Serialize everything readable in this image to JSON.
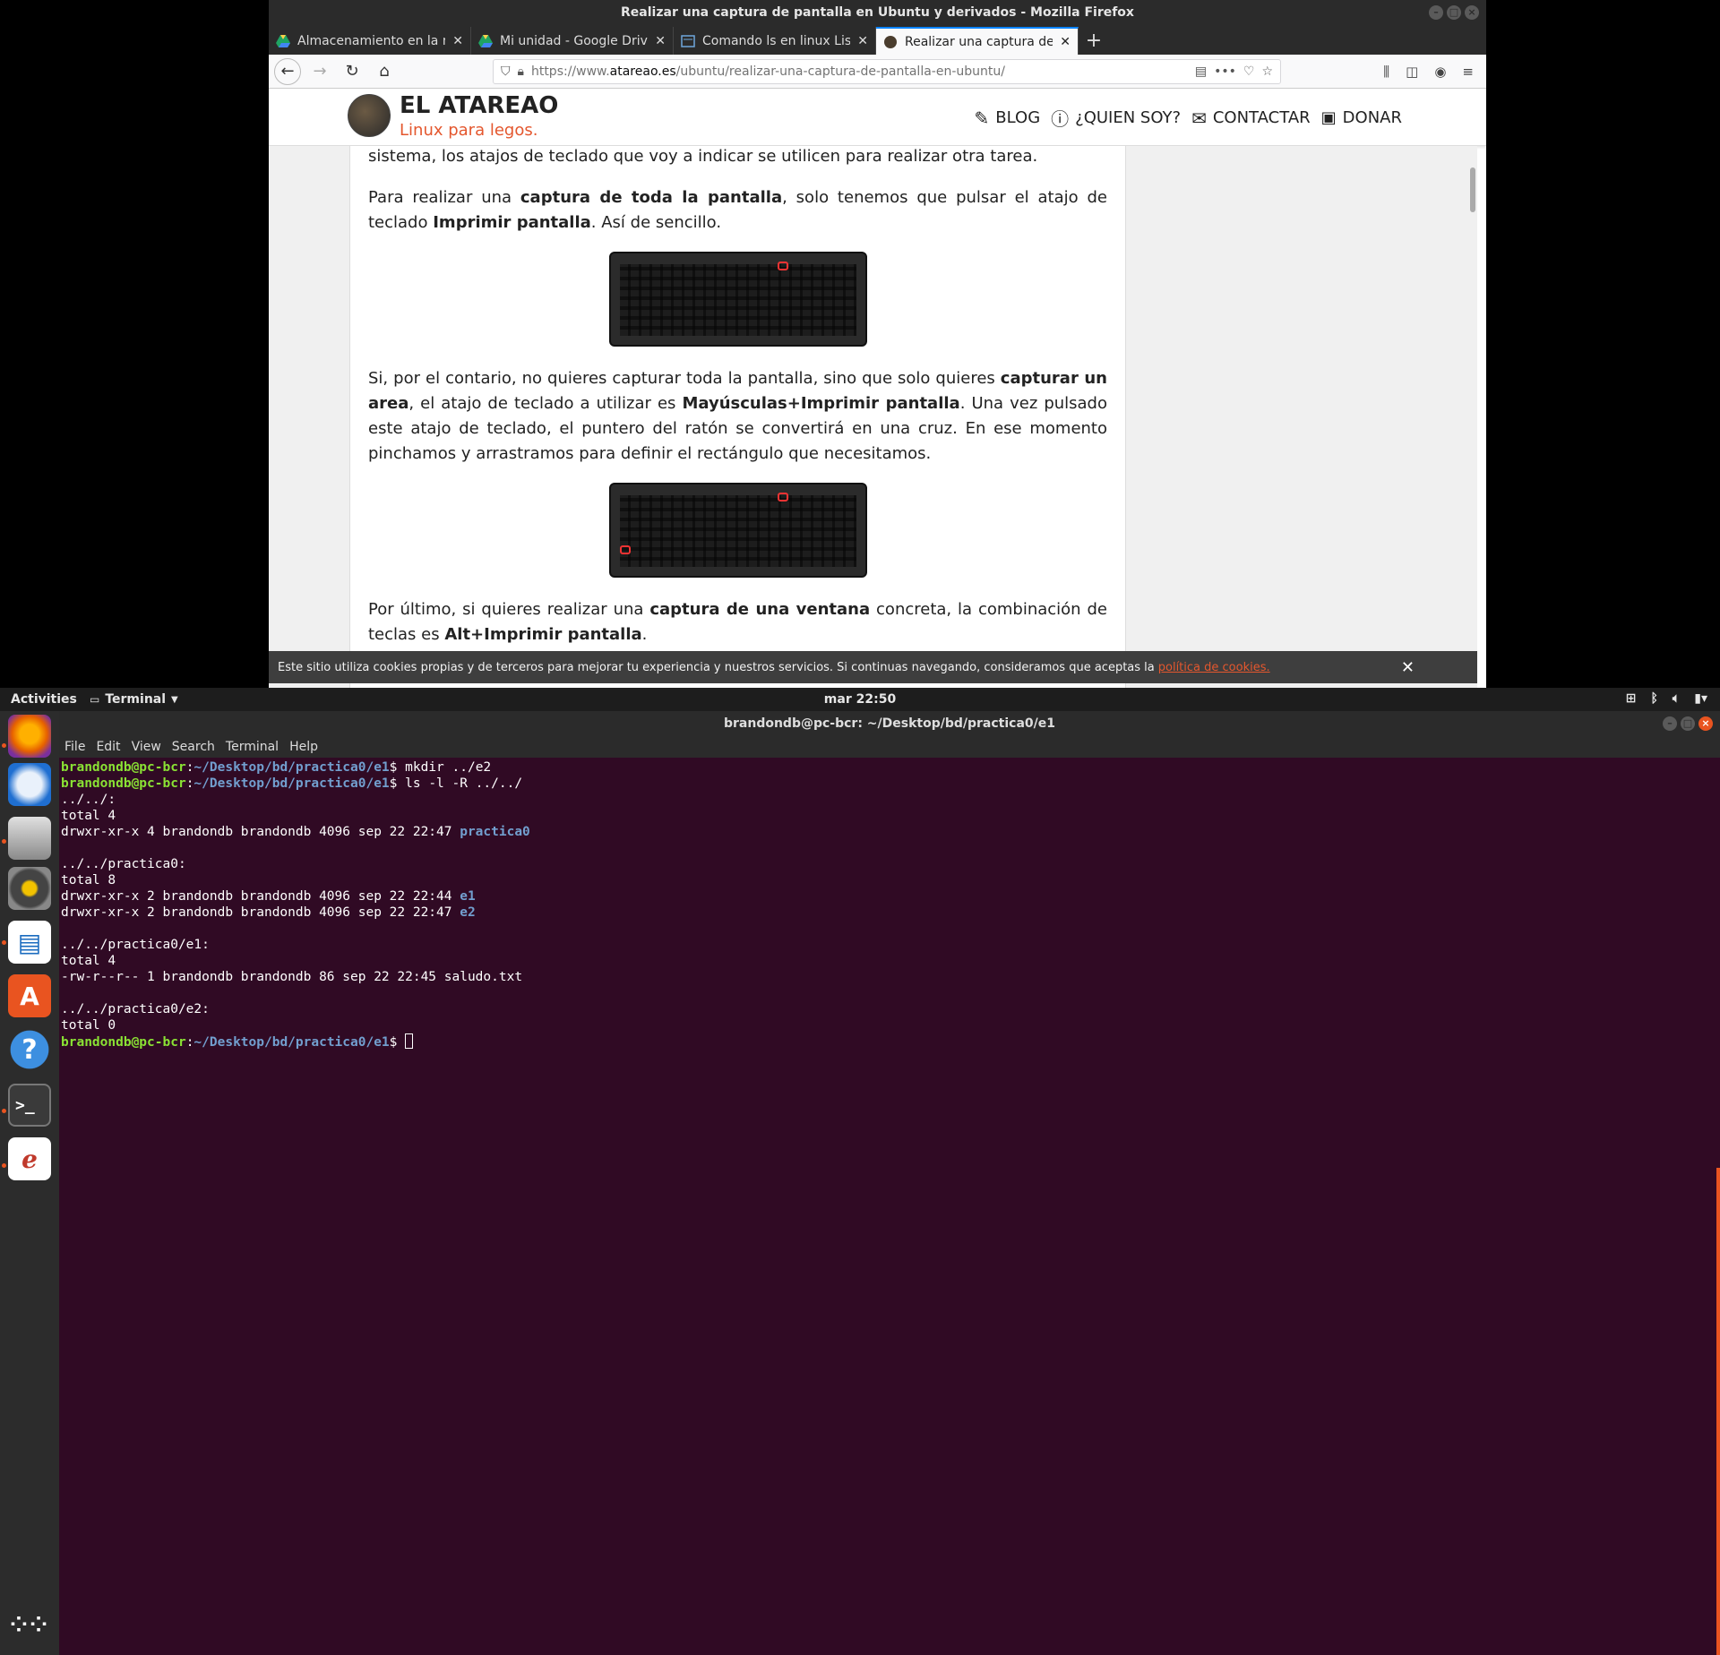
{
  "firefox": {
    "window_title": "Realizar una captura de pantalla en Ubuntu y derivados - Mozilla Firefox",
    "tabs": [
      {
        "label": "Almacenamiento en la n",
        "icon": "google-drive-icon"
      },
      {
        "label": "Mi unidad - Google Drive",
        "icon": "google-drive-icon"
      },
      {
        "label": "Comando ls en linux List",
        "icon": "page-icon"
      },
      {
        "label": "Realizar una captura de p",
        "icon": "atareao-icon",
        "active": true
      }
    ],
    "url_prefix": "https://www.",
    "url_host": "atareao.es",
    "url_path": "/ubuntu/realizar-una-captura-de-pantalla-en-ubuntu/"
  },
  "site": {
    "title": "EL ATAREAO",
    "tagline": "Linux para legos.",
    "menu": [
      "BLOG",
      "¿QUIEN SOY?",
      "CONTACTAR",
      "DONAR"
    ],
    "accent": "#e4572e"
  },
  "article": {
    "p0": "sistema, los atajos de teclado que voy a indicar se utilicen para realizar otra tarea.",
    "p1_a": "Para realizar una ",
    "p1_b": "captura de toda la pantalla",
    "p1_c": ", solo tenemos que pulsar el atajo de teclado ",
    "p1_d": "Imprimir pantalla",
    "p1_e": ". Así de sencillo.",
    "p2_a": "Si, por el contario, no quieres capturar toda la pantalla, sino que solo quieres ",
    "p2_b": "capturar un area",
    "p2_c": ", el atajo de teclado a utilizar es ",
    "p2_d": "Mayúsculas+Imprimir pantalla",
    "p2_e": ". Una vez pulsado este atajo de teclado, el puntero del ratón se convertirá en una cruz. En ese momento pinchamos y arrastramos para definir el rectángulo que necesitamos.",
    "p3_a": "Por último, si quieres realizar una ",
    "p3_b": "captura de una ventana",
    "p3_c": " concreta, la combinación de teclas es ",
    "p3_d": "Alt+Imprimir pantalla",
    "p3_e": "."
  },
  "cookie": {
    "text": "Este sitio utiliza cookies propias y de terceros para mejorar tu experiencia y nuestros servicios. Si continuas navegando, consideramos que aceptas la",
    "link": "política de cookies."
  },
  "topbar": {
    "activities": "Activities",
    "app": "Terminal",
    "clock": "mar 22:50"
  },
  "terminal": {
    "title": "brandondb@pc-bcr: ~/Desktop/bd/practica0/e1",
    "menu": [
      "File",
      "Edit",
      "View",
      "Search",
      "Terminal",
      "Help"
    ],
    "prompt_user": "brandondb@pc-bcr",
    "prompt_path": "~/Desktop/bd/practica0/e1",
    "cmd1": " mkdir ../e2",
    "cmd2": " ls -l -R ../../",
    "l1": "../../:",
    "l2": "total 4",
    "l3": "drwxr-xr-x 4 brandondb brandondb 4096 sep 22 22:47 ",
    "l3d": "practica0",
    "l4": "../../practica0:",
    "l5": "total 8",
    "l6": "drwxr-xr-x 2 brandondb brandondb 4096 sep 22 22:44 ",
    "l6d": "e1",
    "l7": "drwxr-xr-x 2 brandondb brandondb 4096 sep 22 22:47 ",
    "l7d": "e2",
    "l8": "../../practica0/e1:",
    "l9": "total 4",
    "l10": "-rw-r--r-- 1 brandondb brandondb 86 sep 22 22:45 saludo.txt",
    "l11": "../../practica0/e2:",
    "l12": "total 0"
  }
}
